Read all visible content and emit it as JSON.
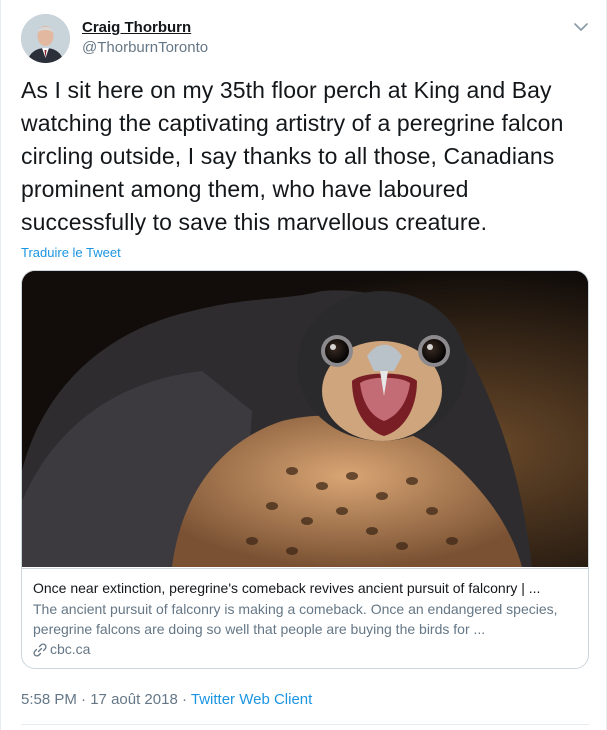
{
  "author": {
    "name": "Craig Thorburn",
    "handle": "@ThorburnToronto"
  },
  "tweet": {
    "text": "As I sit here on my 35th floor perch at King and Bay watching the captivating artistry of a peregrine falcon circling outside, I say thanks to all those, Canadians prominent among them, who have laboured successfully to save this marvellous creature.",
    "translate_label": "Traduire le Tweet"
  },
  "card": {
    "title": "Once near extinction, peregrine's comeback revives ancient pursuit of falconry | ...",
    "description": "The ancient pursuit of falconry is making a comeback. Once an endangered species, peregrine falcons are doing so well that people are buying the birds for ...",
    "domain": "cbc.ca"
  },
  "meta": {
    "time": "5:58 PM",
    "separator1": " · ",
    "date": "17 août 2018",
    "separator2": " · ",
    "client": "Twitter Web Client"
  },
  "icons": {
    "caret": "chevron-down-icon",
    "link": "link-icon"
  },
  "colors": {
    "accent": "#1b95e0",
    "text": "#14171a",
    "secondary": "#657786",
    "border": "#ccd6dd"
  }
}
